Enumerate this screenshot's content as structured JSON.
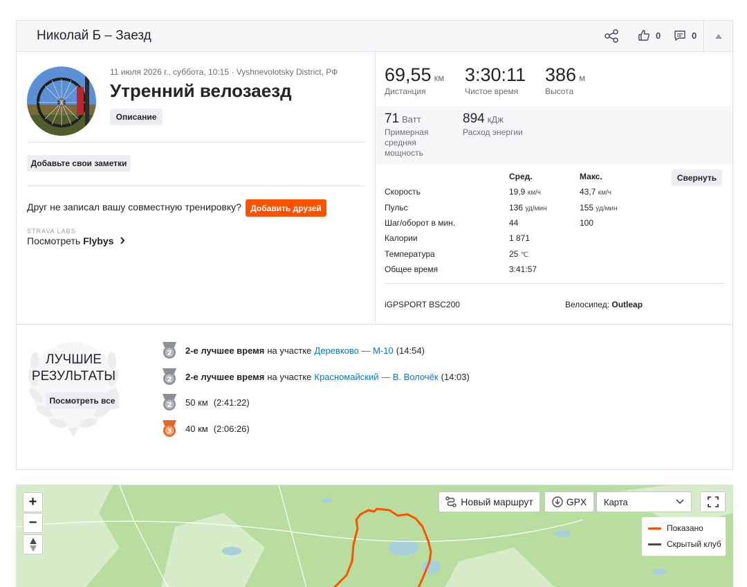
{
  "header": {
    "title": "Николай Б – Заезд",
    "kudos_count": "0",
    "comments_count": "0"
  },
  "activity": {
    "date": "11 июля 2026 г., суббота, 10:15",
    "location": "Vyshnevolotsky District, РФ",
    "title": "Утренний велозаезд",
    "description_btn": "Описание",
    "notes_btn": "Добавьте свои заметки",
    "friend_prompt": "Друг не записал вашу совместную тренировку?",
    "add_friends_btn": "Добавить друзей",
    "labs_label": "STRAVA LABS",
    "flybys_prefix": "Посмотреть",
    "flybys_name": "Flybys"
  },
  "stats": {
    "distance": {
      "value": "69,55",
      "unit": "км",
      "label": "Дистанция"
    },
    "moving_time": {
      "value": "3:30:11",
      "label": "Чистое время"
    },
    "elevation": {
      "value": "386",
      "unit": "м",
      "label": "Высота"
    },
    "power": {
      "value": "71",
      "unit": "Ватт",
      "label_1": "Примерная",
      "label_2": "средняя",
      "label_3": "мощность"
    },
    "energy": {
      "value": "894",
      "unit": "кДж",
      "label": "Расход энергии"
    }
  },
  "table": {
    "col_avg": "Сред.",
    "col_max": "Макс.",
    "collapse_btn": "Свернуть",
    "rows": [
      {
        "label": "Скорость",
        "avg": "19,9",
        "avg_unit": "км/ч",
        "max": "43,7",
        "max_unit": "км/ч"
      },
      {
        "label": "Пульс",
        "avg": "136",
        "avg_unit": "уд/мин",
        "max": "155",
        "max_unit": "уд/мин"
      },
      {
        "label": "Шаг/оборот в мин.",
        "avg": "44",
        "avg_unit": "",
        "max": "100",
        "max_unit": ""
      },
      {
        "label": "Калории",
        "avg": "1 871",
        "avg_unit": "",
        "max": "",
        "max_unit": ""
      },
      {
        "label": "Температура",
        "avg": "25",
        "avg_unit": "℃",
        "max": "",
        "max_unit": ""
      },
      {
        "label": "Общее время",
        "avg": "3:41:57",
        "avg_unit": "",
        "max": "",
        "max_unit": ""
      }
    ],
    "device": "iGPSPORT BSC200",
    "bike_label": "Велосипед:",
    "bike_name": "Outleap"
  },
  "results": {
    "title_1": "ЛУЧШИЕ",
    "title_2": "РЕЗУЛЬТАТЫ",
    "view_all_btn": "Посмотреть все",
    "items": [
      {
        "medal": "2",
        "bold": "2-е лучшее время",
        "text": "на участке",
        "link": "Деревково — М-10",
        "time": "(14:54)"
      },
      {
        "medal": "2",
        "bold": "2-е лучшее время",
        "text": "на участке",
        "link": "Красномайский — В. Волочёк",
        "time": "(14:03)"
      },
      {
        "medal": "2",
        "bold": "",
        "text": "50 км",
        "link": "",
        "time": "(2:41:22)"
      },
      {
        "medal": "3",
        "bold": "",
        "text": "40 км",
        "link": "",
        "time": "(2:06:26)"
      }
    ]
  },
  "map": {
    "zoom_in": "+",
    "zoom_out": "−",
    "new_route_btn": "Новый маршрут",
    "gpx_btn": "GPX",
    "map_type": "Карта",
    "legend_shown": "Показано",
    "legend_hidden": "Скрытый клуб",
    "route_color": "#fc5200",
    "hidden_color": "#4a4a52"
  },
  "colors": {
    "accent": "#fc5200",
    "link": "#0a77b5",
    "silver": "#8a9096",
    "bronze": "#e0682a"
  }
}
